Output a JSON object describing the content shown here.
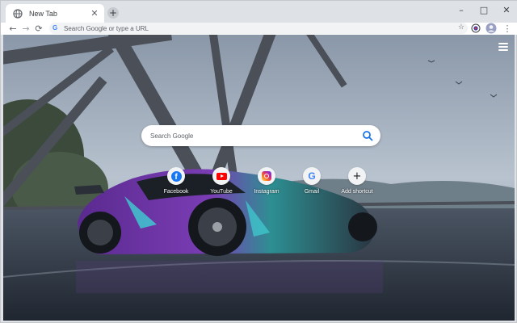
{
  "tab": {
    "title": "New Tab",
    "close_glyph": "✕",
    "icon": "globe-icon"
  },
  "newtab_glyph": "+",
  "window_controls": {
    "minimize": "–",
    "maximize": "□",
    "close": "✕"
  },
  "toolbar": {
    "back_glyph": "←",
    "forward_glyph": "→",
    "reload_glyph": "⟳",
    "address_placeholder": "Search Google or type a URL",
    "bookmark_glyph": "☆",
    "menu_glyph": "⋮"
  },
  "ntp": {
    "search_placeholder": "Search Google",
    "shortcuts": [
      {
        "label": "Facebook",
        "icon": "facebook-icon"
      },
      {
        "label": "YouTube",
        "icon": "youtube-icon"
      },
      {
        "label": "Instagram",
        "icon": "instagram-icon"
      },
      {
        "label": "Gmail",
        "icon": "google-icon"
      },
      {
        "label": "Add shortcut",
        "icon": "plus-icon"
      }
    ]
  },
  "colors": {
    "tabstrip": "#dee1e6",
    "toolbar": "#ffffff",
    "omnibox": "#f1f3f4",
    "google_blue": "#4285f4"
  }
}
